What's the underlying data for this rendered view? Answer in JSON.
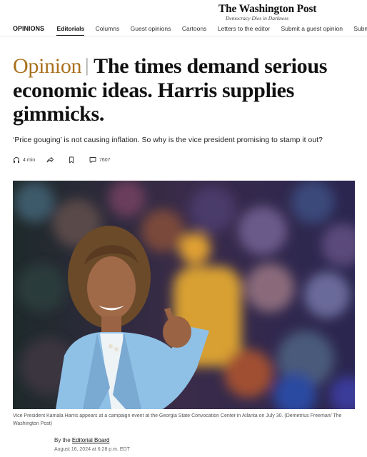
{
  "masthead": {
    "logo": "The Washington Post",
    "tagline": "Democracy Dies in Darkness"
  },
  "nav": {
    "section": "OPINIONS",
    "items": [
      {
        "label": "Editorials",
        "active": true
      },
      {
        "label": "Columns",
        "active": false
      },
      {
        "label": "Guest opinions",
        "active": false
      },
      {
        "label": "Cartoons",
        "active": false
      },
      {
        "label": "Letters to the editor",
        "active": false
      },
      {
        "label": "Submit a guest opinion",
        "active": false
      },
      {
        "label": "Submit",
        "active": false
      }
    ]
  },
  "article": {
    "kicker": "Opinion",
    "headline": "The times demand serious economic ideas. Harris supplies gimmicks.",
    "headline_line1": "The times demand serious",
    "headline_line2": "economic ideas. Harris supplies",
    "headline_line3": "gimmicks.",
    "dek": "‘Price gouging’ is not causing inflation. So why is the vice president promising to stamp it out?",
    "tools": {
      "listen_label": "4 min",
      "share_icon": "share-icon",
      "save_icon": "bookmark-icon",
      "comment_count": "7607"
    },
    "caption": "Vice President Kamala Harris appears at a campaign event at the Georgia State Convocation Center in Atlanta on July 30. (Demetrius Freeman/ The Washington Post)",
    "byline_prefix": "By the",
    "byline_author": "Editorial Board",
    "date": "August 16, 2024 at 6:28 p.m. EDT"
  },
  "colors": {
    "kicker": "#a9701c",
    "text": "#111111",
    "photo_backdrop": "#2b2440",
    "jacket": "#8fc0e6"
  }
}
